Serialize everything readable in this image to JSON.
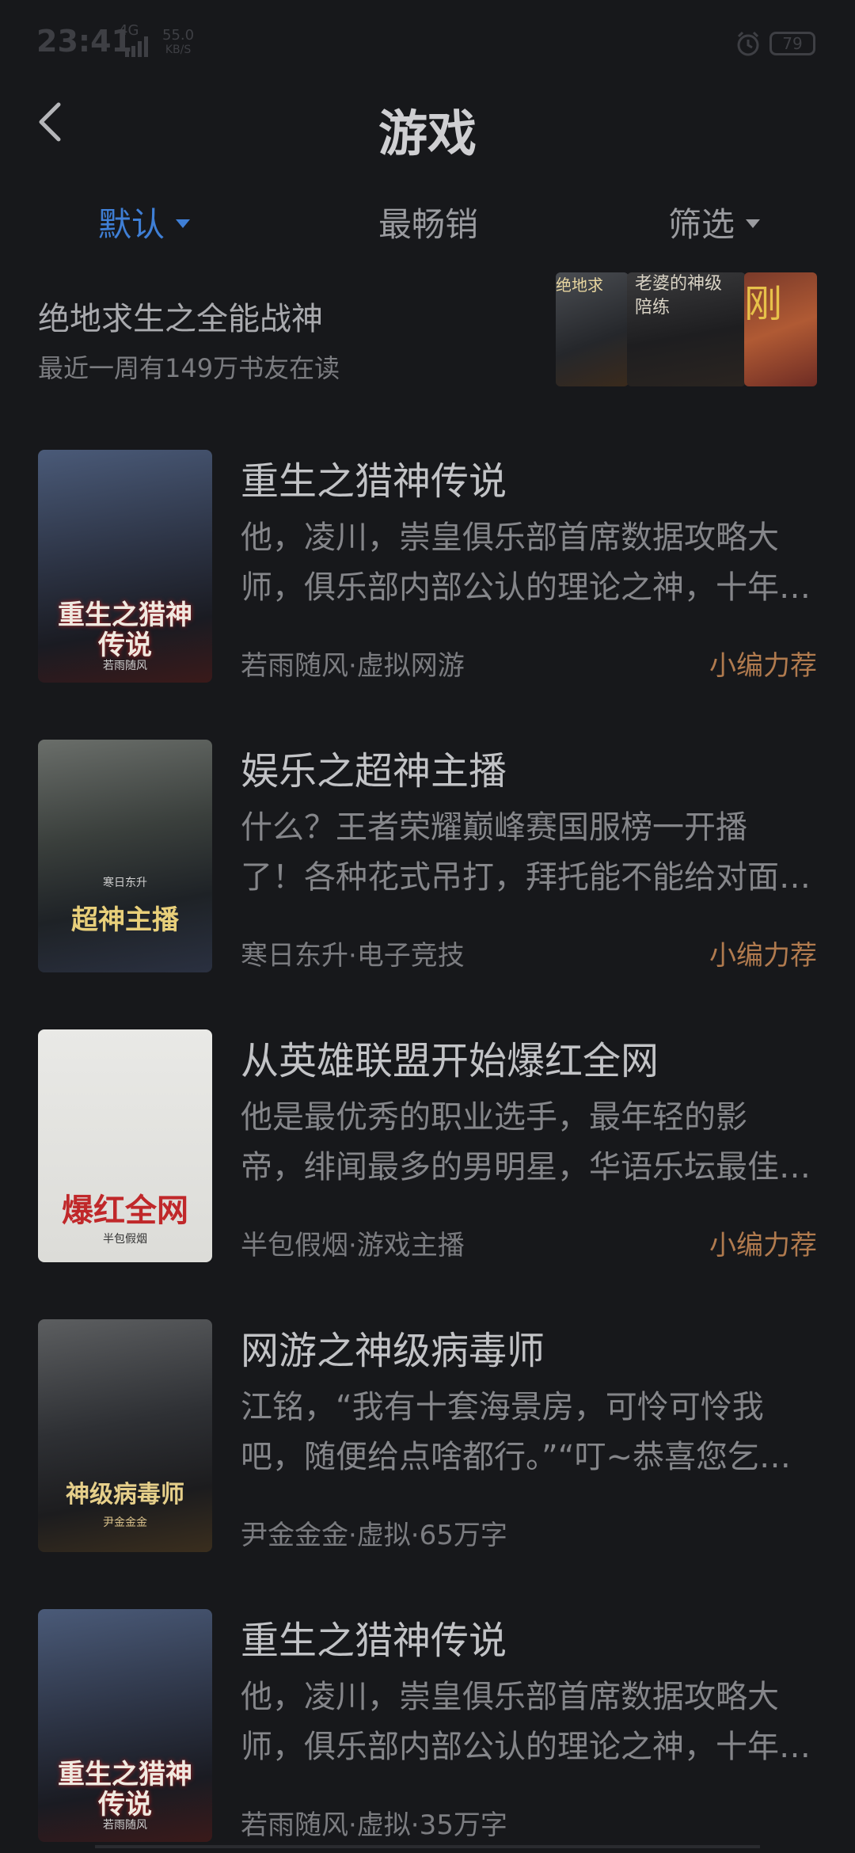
{
  "status_bar": {
    "time": "23:41",
    "network": "4G",
    "speed_value": "55.0",
    "speed_unit": "KB/S",
    "battery": "79"
  },
  "header": {
    "title": "游戏"
  },
  "tabs": [
    {
      "label": "默认"
    },
    {
      "label": "最畅销"
    },
    {
      "label": "筛选"
    }
  ],
  "featured": {
    "title": "绝地求生之全能战神",
    "subtitle": "最近一周有149万书友在读",
    "covers": [
      {
        "text": "绝地求"
      },
      {
        "text": "老婆的神级陪练"
      },
      {
        "text": "刚"
      }
    ]
  },
  "books": [
    {
      "title": "重生之猎神传说",
      "desc_line1": "他，凌川，崇皇俱乐部首席数据攻略大",
      "desc_line2": "师，俱乐部内部公认的理论之神，十年…",
      "meta": "若雨随风·虚拟网游",
      "tag": "小编力荐",
      "cover_text": "重生之猎神传说",
      "cover_author": "若雨随风"
    },
    {
      "title": "娱乐之超神主播",
      "desc_line1": "什么？王者荣耀巅峰赛国服榜一开播",
      "desc_line2": "了！各种花式吊打，拜托能不能给对面…",
      "meta": "寒日东升·电子竞技",
      "tag": "小编力荐",
      "cover_text": "超神主播",
      "cover_author": "寒日东升"
    },
    {
      "title": "从英雄联盟开始爆红全网",
      "desc_line1": "他是最优秀的职业选手，最年轻的影",
      "desc_line2": "帝，绯闻最多的男明星，华语乐坛最佳…",
      "meta": "半包假烟·游戏主播",
      "tag": "小编力荐",
      "cover_text": "爆红全网",
      "cover_author": "半包假烟"
    },
    {
      "title": "网游之神级病毒师",
      "desc_line1": "江铭，“我有十套海景房，可怜可怜我",
      "desc_line2": "吧，随便给点啥都行。”“叮~恭喜您乞…",
      "meta": "尹金金金·虚拟·65万字",
      "tag": "",
      "cover_text": "神级病毒师",
      "cover_author": "尹金金金"
    },
    {
      "title": "重生之猎神传说",
      "desc_line1": "他，凌川，崇皇俱乐部首席数据攻略大",
      "desc_line2": "师，俱乐部内部公认的理论之神，十年…",
      "meta": "若雨随风·虚拟·35万字",
      "tag": "",
      "cover_text": "重生之猎神传说",
      "cover_author": "若雨随风"
    }
  ],
  "colors": {
    "background": "#17181b",
    "accent_blue": "#3f7fd6",
    "tag_orange": "#b07a4e"
  }
}
